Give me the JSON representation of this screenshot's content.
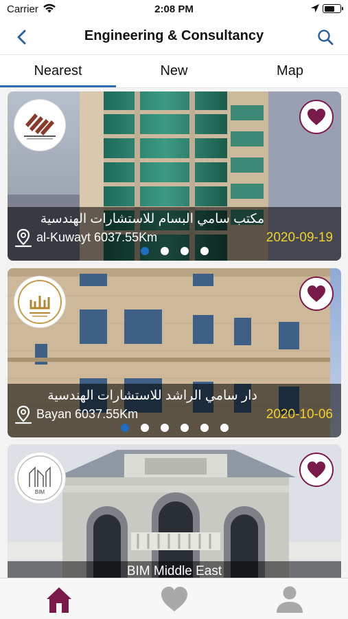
{
  "status_bar": {
    "carrier": "Carrier",
    "time": "2:08 PM",
    "icons": [
      "wifi-icon",
      "location-arrow-icon",
      "battery-icon"
    ]
  },
  "nav": {
    "title": "Engineering & Consultancy",
    "back_icon": "chevron-left-icon",
    "search_icon": "search-icon"
  },
  "tabs": [
    {
      "label": "Nearest",
      "active": true
    },
    {
      "label": "New",
      "active": false
    },
    {
      "label": "Map",
      "active": false
    }
  ],
  "listings": [
    {
      "name": "مكتب سامي البسام للاستشارات الهندسية",
      "location": "al-Kuwayt 6037.55Km",
      "date": "2020-09-19",
      "dots": 4,
      "active_dot": 0,
      "favorited": true
    },
    {
      "name": "دار سامي الراشد للاستشارات الهندسية",
      "location": "Bayan 6037.55Km",
      "date": "2020-10-06",
      "dots": 6,
      "active_dot": 0,
      "favorited": true
    },
    {
      "name": "BIM Middle East",
      "favorited": true,
      "logo_text": "BIM"
    }
  ],
  "tab_bar": {
    "items": [
      "home-icon",
      "heart-icon",
      "profile-icon"
    ],
    "active": "home-icon"
  },
  "colors": {
    "accent": "#7a1a4a",
    "tab_underline": "#2b6cb0",
    "date": "#f2d02b",
    "active_dot": "#1e6dc2",
    "inactive_icon": "#a9a9a9"
  }
}
